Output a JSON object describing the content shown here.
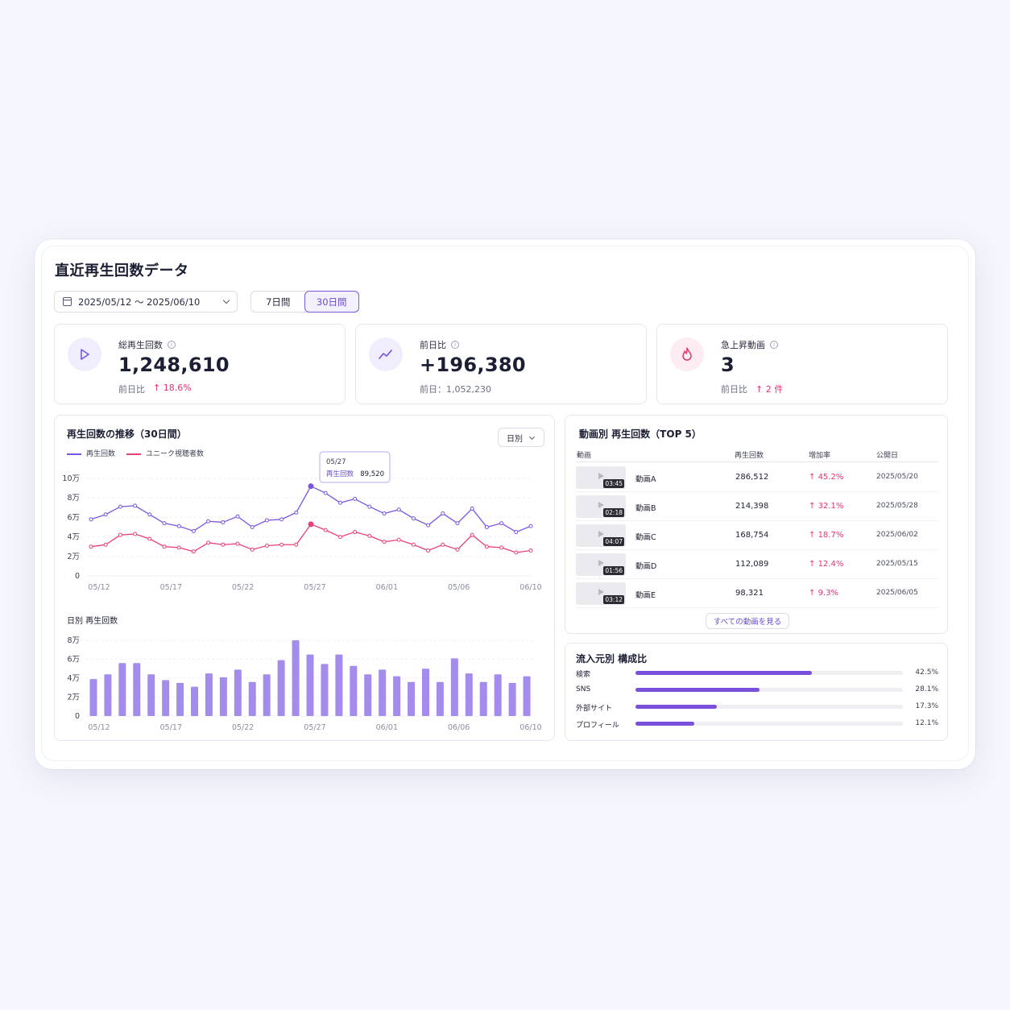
{
  "page": {
    "title": "直近再生回数データ",
    "date_range": "2025/05/12 〜 2025/06/10",
    "period_options": [
      "7日間",
      "30日間"
    ],
    "active_period": "30日間"
  },
  "kpis": [
    {
      "label": "総再生回数",
      "value": "1,248,610",
      "sub_label": "前日比",
      "sub_value": "18.6%",
      "icon": "play-icon"
    },
    {
      "label": "前日比",
      "value": "+196,380",
      "sub_label": "前日：1,052,230",
      "sub_value": "",
      "icon": "trend-icon"
    },
    {
      "label": "急上昇動画",
      "value": "3",
      "sub_label": "前日比",
      "sub_value": "2 件",
      "icon": "flame-icon"
    }
  ],
  "trend": {
    "title": "再生回数の推移（30日間）",
    "dropdown": "日別",
    "legend": [
      "再生回数",
      "ユニーク視聴者数"
    ],
    "tooltip": {
      "date": "05/27",
      "label": "再生回数",
      "value": "89,520"
    }
  },
  "daily": {
    "title": "日別 再生回数"
  },
  "chart_data": [
    {
      "type": "line",
      "x_ticks": [
        "05/12",
        "05/17",
        "05/22",
        "05/27",
        "06/01",
        "05/06",
        "06/10"
      ],
      "y_ticks": [
        "0",
        "2万",
        "4万",
        "6万",
        "8万",
        "10万"
      ],
      "ylim": [
        0,
        100000
      ],
      "series": [
        {
          "name": "再生回数",
          "color": "#7a55e0",
          "values": [
            58000,
            63000,
            71000,
            72000,
            63000,
            54000,
            51000,
            46000,
            56000,
            55000,
            61000,
            50000,
            57000,
            58000,
            65000,
            92000,
            85000,
            75000,
            79000,
            71000,
            64000,
            68000,
            59000,
            52000,
            64000,
            54000,
            69000,
            50000,
            54000,
            45000,
            51000
          ]
        },
        {
          "name": "ユニーク視聴者数",
          "color": "#ea3f7d",
          "values": [
            30000,
            32000,
            42000,
            43000,
            38000,
            30000,
            29000,
            25000,
            34000,
            32000,
            33000,
            27000,
            31000,
            32000,
            32000,
            53000,
            47000,
            40000,
            45000,
            41000,
            35000,
            37000,
            32000,
            26000,
            32000,
            27000,
            42000,
            30000,
            29000,
            24000,
            26000
          ]
        }
      ]
    },
    {
      "type": "bar",
      "x_ticks": [
        "05/12",
        "05/17",
        "05/22",
        "05/27",
        "06/01",
        "06/06",
        "06/10"
      ],
      "y_ticks": [
        "0",
        "2万",
        "4万",
        "6万",
        "8万"
      ],
      "ylim": [
        0,
        80000
      ],
      "values": [
        39000,
        44000,
        56000,
        56000,
        44000,
        38000,
        35000,
        31000,
        45000,
        41000,
        49000,
        36000,
        44000,
        59000,
        80000,
        65000,
        55000,
        65000,
        53000,
        44000,
        49000,
        42000,
        36000,
        50000,
        36000,
        61000,
        45000,
        36000,
        44000,
        35000,
        42000
      ]
    }
  ],
  "top_videos": {
    "title": "動画別 再生回数（TOP 5）",
    "headers": [
      "動画",
      "再生回数",
      "増加率",
      "公開日"
    ],
    "rows": [
      {
        "name": "動画A",
        "duration": "03:45",
        "plays": "286,512",
        "rate": "45.2%",
        "date": "2025/05/20"
      },
      {
        "name": "動画B",
        "duration": "02:18",
        "plays": "214,398",
        "rate": "32.1%",
        "date": "2025/05/28"
      },
      {
        "name": "動画C",
        "duration": "04:07",
        "plays": "168,754",
        "rate": "18.7%",
        "date": "2025/06/02"
      },
      {
        "name": "動画D",
        "duration": "01:56",
        "plays": "112,089",
        "rate": "12.4%",
        "date": "2025/05/15"
      },
      {
        "name": "動画E",
        "duration": "03:12",
        "plays": "98,321",
        "rate": "9.3%",
        "date": "2025/06/05"
      }
    ],
    "see_all": "すべての動画を見る"
  },
  "sources": {
    "title": "流入元別 構成比",
    "items": [
      {
        "label": "検索",
        "pct": "42.5%",
        "value": 0.66
      },
      {
        "label": "SNS",
        "pct": "28.1%",
        "value": 0.465
      },
      {
        "label": "外部サイト",
        "pct": "17.3%",
        "value": 0.305
      },
      {
        "label": "プロフィール",
        "pct": "12.1%",
        "value": 0.22
      }
    ]
  }
}
